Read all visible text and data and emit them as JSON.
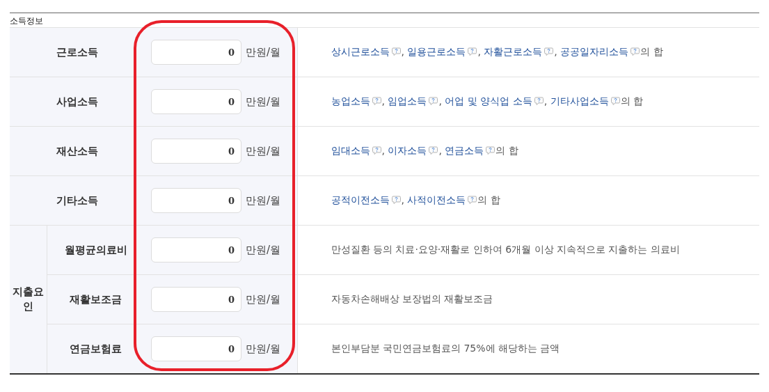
{
  "caption": "소득정보",
  "value_column_highlighted": true,
  "income_rows": [
    {
      "label": "근로소득",
      "value": "0",
      "unit": "만원/월",
      "description": {
        "links": [
          {
            "text": "상시근로소득",
            "separator": ", "
          },
          {
            "text": "일용근로소득",
            "separator": ", "
          },
          {
            "text": "자활근로소득",
            "separator": ", "
          },
          {
            "text": "공공일자리소득"
          }
        ],
        "tail": "의 합"
      }
    },
    {
      "label": "사업소득",
      "value": "0",
      "unit": "만원/월",
      "description": {
        "links": [
          {
            "text": "농업소득",
            "separator": ", "
          },
          {
            "text": "임업소득",
            "separator": ", "
          },
          {
            "text": "어업 및 양식업 소득",
            "separator": ", "
          },
          {
            "text": "기타사업소득"
          }
        ],
        "tail": "의 합"
      }
    },
    {
      "label": "재산소득",
      "value": "0",
      "unit": "만원/월",
      "description": {
        "links": [
          {
            "text": "임대소득",
            "separator": ", "
          },
          {
            "text": "이자소득",
            "separator": ", "
          },
          {
            "text": "연금소득"
          }
        ],
        "tail": "의 합"
      }
    },
    {
      "label": "기타소득",
      "value": "0",
      "unit": "만원/월",
      "description": {
        "links": [
          {
            "text": "공적이전소득",
            "separator": ", "
          },
          {
            "text": "사적이전소득"
          }
        ],
        "tail": "의 합"
      }
    }
  ],
  "expense_group": {
    "label": "지출요인",
    "rows": [
      {
        "label": "월평균의료비",
        "value": "0",
        "unit": "만원/월",
        "description": {
          "tail": "만성질환 등의 치료·요양·재활로 인하여 6개월 이상 지속적으로 지출하는 의료비"
        }
      },
      {
        "label": "재활보조금",
        "value": "0",
        "unit": "만원/월",
        "description": {
          "tail": "자동차손해배상 보장법의 재활보조금"
        }
      },
      {
        "label": "연금보험료",
        "value": "0",
        "unit": "만원/월",
        "description": {
          "tail": "본인부담분 국민연금보험료의 75%에 해당하는 금액"
        }
      }
    ]
  }
}
